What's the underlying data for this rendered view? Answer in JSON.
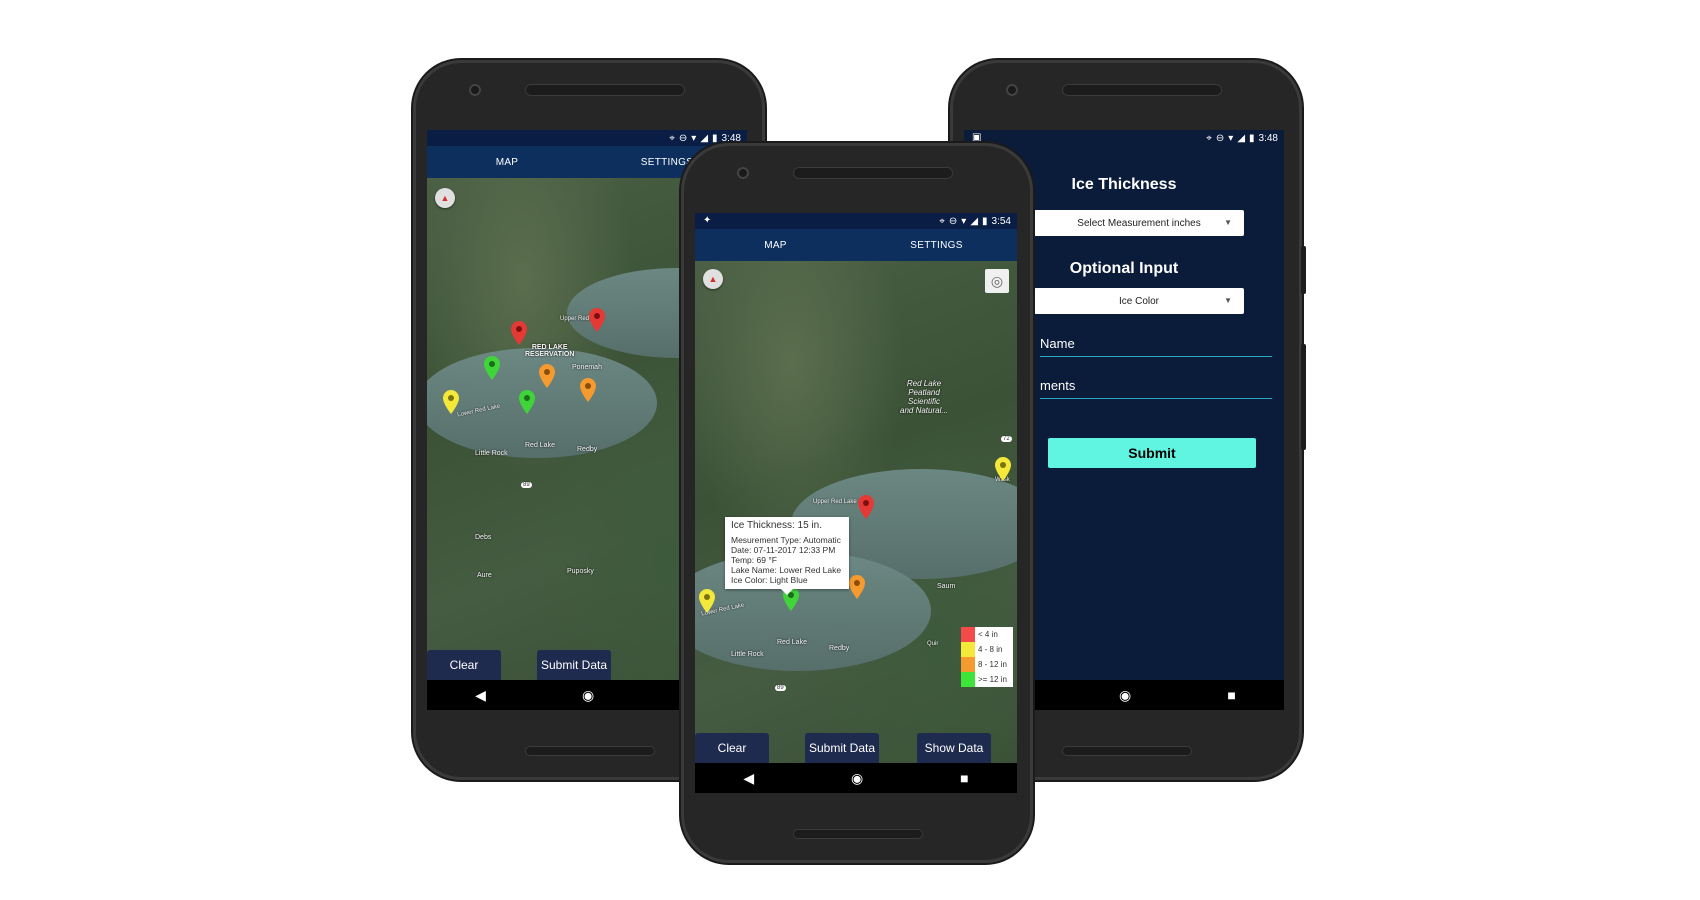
{
  "colors": {
    "red": "#e53935",
    "yellow": "#f4e83a",
    "orange": "#f59a2f",
    "green": "#3fd43a",
    "navy": "#0b1b3a",
    "tabbar": "#0d2f5e",
    "button": "#1e2a4e",
    "submit": "#5ff5e1"
  },
  "left_phone": {
    "status": {
      "time": "3:48"
    },
    "tabs": [
      {
        "label": "MAP"
      },
      {
        "label": "SETTINGS"
      }
    ],
    "map_labels": {
      "reservation": "RED LAKE\nRESERVATION",
      "upper": "Upper Red Lake",
      "ponemah": "Ponemah",
      "lower": "Lower Red Lake",
      "red_lake": "Red Lake",
      "redby": "Redby",
      "little_rock": "Little Rock",
      "debs": "Debs",
      "aure": "Aure",
      "puposky": "Puposky",
      "route": "89"
    },
    "buttons": {
      "clear": "Clear",
      "submit": "Submit Data"
    }
  },
  "middle_phone": {
    "status": {
      "time": "3:54"
    },
    "tabs": [
      {
        "label": "MAP"
      },
      {
        "label": "SETTINGS"
      }
    ],
    "map_labels": {
      "peatland": "Red Lake\nPeatland\nScientific\nand Natural...",
      "upper": "Upper Red Lake",
      "lower": "Lower Red Lake",
      "red_lake": "Red Lake",
      "redby": "Redby",
      "little_rock": "Little Rock",
      "saum": "Saum",
      "route": "89",
      "route72": "72",
      "waskish": "Wask",
      "quiring": "Quir"
    },
    "popup": {
      "thickness": "Ice Thickness: 15 in.",
      "type": "Mesurement Type: Automatic",
      "date": "Date: 07-11-2017 12:33 PM",
      "temp": "Temp: 69 °F",
      "lake": "Lake Name: Lower Red Lake",
      "color": "Ice Color: Light Blue"
    },
    "legend": [
      {
        "label": "< 4 in",
        "color": "#f44a4a"
      },
      {
        "label": "4 - 8 in",
        "color": "#f4e83a"
      },
      {
        "label": "8 - 12 in",
        "color": "#f59a2f"
      },
      {
        "label": ">= 12 in",
        "color": "#3fe43a"
      }
    ],
    "buttons": {
      "clear": "Clear",
      "submit": "Submit Data",
      "show": "Show Data"
    }
  },
  "right_phone": {
    "status": {
      "time": "3:48"
    },
    "title": "Ice Thickness",
    "measurement_select": "Select Measurement inches",
    "optional_title": "Optional Input",
    "ice_color_select": "Ice Color",
    "name_label": "Name",
    "comments_label": "ments",
    "submit_label": "Submit"
  },
  "nav": {
    "back": "◀",
    "home": "◉",
    "recent": "■"
  }
}
